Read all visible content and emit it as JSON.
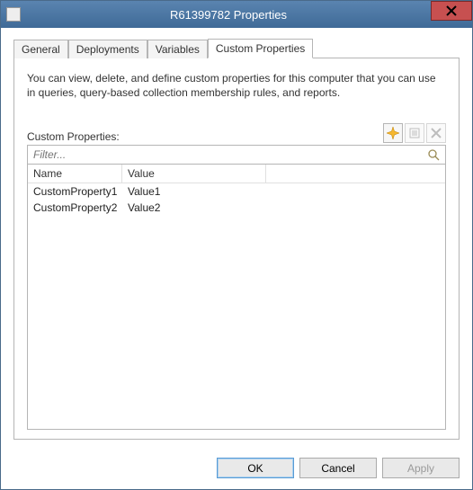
{
  "window": {
    "title": "R61399782 Properties"
  },
  "tabs": {
    "items": [
      {
        "label": "General"
      },
      {
        "label": "Deployments"
      },
      {
        "label": "Variables"
      },
      {
        "label": "Custom Properties"
      }
    ],
    "active_index": 3
  },
  "panel": {
    "description": "You can view, delete, and define custom properties for this computer that you can use in queries, query-based collection membership rules, and reports.",
    "section_label": "Custom Properties:"
  },
  "toolbar": {
    "new_tooltip": "New",
    "edit_tooltip": "Edit",
    "delete_tooltip": "Delete"
  },
  "filter": {
    "placeholder": "Filter..."
  },
  "list": {
    "columns": [
      {
        "label": "Name"
      },
      {
        "label": "Value"
      }
    ],
    "rows": [
      {
        "name": "CustomProperty1",
        "value": "Value1"
      },
      {
        "name": "CustomProperty2",
        "value": "Value2"
      }
    ]
  },
  "buttons": {
    "ok": "OK",
    "cancel": "Cancel",
    "apply": "Apply"
  }
}
